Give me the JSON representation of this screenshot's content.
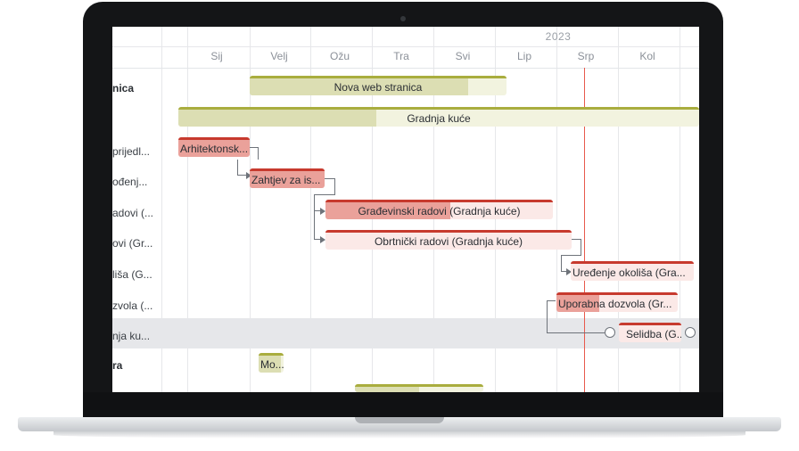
{
  "gantt": {
    "year": "2023",
    "months": [
      "Sij",
      "Velj",
      "Ožu",
      "Tra",
      "Svi",
      "Lip",
      "Srp",
      "Kol"
    ],
    "labels": [
      "nica",
      "prijedl...",
      "ođenj...",
      "adovi (...",
      "ovi (Gr...",
      "liša (G...",
      "zvola (...",
      "nja ku...",
      "ra"
    ],
    "bars": {
      "nova_web_stranica": {
        "label": "Nova web stranica",
        "progress": 0.85
      },
      "gradnja_kuce": {
        "label": "Gradnja kuće",
        "progress": 0.38
      },
      "arhitektonski": {
        "label": "Arhitektonsk...",
        "progress": 1.0
      },
      "zahtjev": {
        "label": "Zahtjev za is...",
        "progress": 1.0
      },
      "gradevinski": {
        "label": "Građevinski radovi (Gradnja kuće)",
        "progress": 0.55
      },
      "obrtnicki": {
        "label": "Obrtnički radovi (Gradnja kuće)",
        "progress": 0.0
      },
      "uredenje": {
        "label": "Uređenje okoliša (Gra...",
        "progress": 0.0
      },
      "uporabna": {
        "label": "Uporabna dozvola (Gr...",
        "progress": 0.35
      },
      "selidba": {
        "label": "Selidba (G...",
        "progress": 0.0
      },
      "mo": {
        "label": "Mo...",
        "progress": 0.9
      },
      "bottom": {
        "label": "",
        "progress": 0.5
      }
    }
  }
}
